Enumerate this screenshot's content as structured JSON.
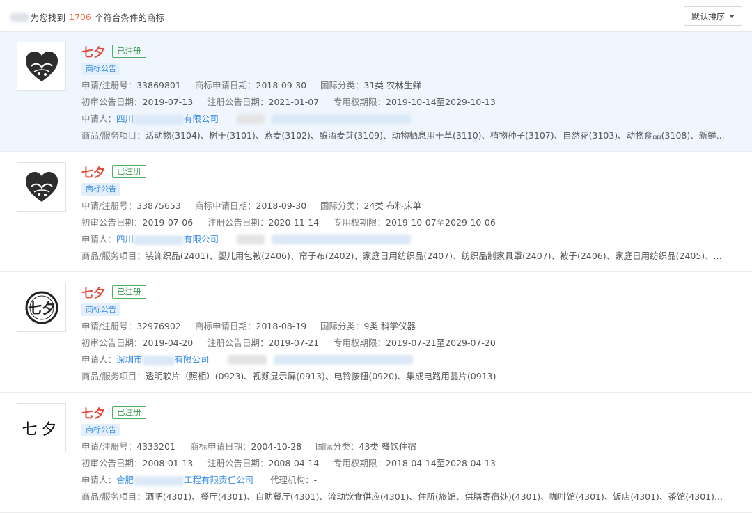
{
  "header": {
    "found_prefix": "为您找到",
    "count": "1706",
    "found_suffix": "个符合条件的商标",
    "sort_label": "默认排序"
  },
  "labels": {
    "reg_no": "申请/注册号：",
    "apply_date": "商标申请日期：",
    "intl_class": "国际分类：",
    "prelim_date": "初审公告日期：",
    "reg_date": "注册公告日期：",
    "exclusive": "专用权期限：",
    "applicant": "申请人：",
    "agent": "代理机构：",
    "goods": "商品/服务项目："
  },
  "items": [
    {
      "name": "七夕",
      "status": "已注册",
      "tag": "商标公告",
      "reg_no": "33869801",
      "apply_date": "2018-09-30",
      "intl_class": "31类 农林生鲜",
      "prelim_date": "2019-07-13",
      "reg_date": "2021-01-07",
      "exclusive": "2019-10-14至2029-10-13",
      "applicant_a": "四川",
      "applicant_b": "有限公司",
      "goods": "活动物(3104)、树干(3101)、燕麦(3102)、酿酒麦芽(3109)、动物栖息用干草(3110)、植物种子(3107)、自然花(3103)、动物食品(3108)、新鲜..."
    },
    {
      "name": "七夕",
      "status": "已注册",
      "tag": "商标公告",
      "reg_no": "33875653",
      "apply_date": "2018-09-30",
      "intl_class": "24类 布料床单",
      "prelim_date": "2019-07-06",
      "reg_date": "2020-11-14",
      "exclusive": "2019-10-07至2029-10-06",
      "applicant_a": "四川",
      "applicant_b": "有限公司",
      "goods": "装饰织品(2401)、婴儿用包被(2406)、帘子布(2402)、家庭日用纺织品(2407)、纺织品制家具罩(2407)、被子(2406)、家庭日用纺织品(2405)、..."
    },
    {
      "name": "七夕",
      "status": "已注册",
      "tag": "商标公告",
      "reg_no": "32976902",
      "apply_date": "2018-08-19",
      "intl_class": "9类 科学仪器",
      "prelim_date": "2019-04-20",
      "reg_date": "2019-07-21",
      "exclusive": "2019-07-21至2029-07-20",
      "applicant_a": "深圳市",
      "applicant_b": "有限公司",
      "goods": "透明软片（照相）(0923)、视频显示屏(0913)、电铃按钮(0920)、集成电路用晶片(0913)"
    },
    {
      "name": "七夕",
      "status": "已注册",
      "tag": "商标公告",
      "reg_no": "4333201",
      "apply_date": "2004-10-28",
      "intl_class": "43类 餐饮住宿",
      "prelim_date": "2008-01-13",
      "reg_date": "2008-04-14",
      "exclusive": "2018-04-14至2028-04-13",
      "applicant_a": "合肥",
      "applicant_b": "工程有限责任公司",
      "agent": "-",
      "goods": "酒吧(4301)、餐厅(4301)、自助餐厅(4301)、流动饮食供应(4301)、住所(旅馆、供膳寄宿处)(4301)、咖啡馆(4301)、饭店(4301)、茶馆(4301)..."
    }
  ]
}
